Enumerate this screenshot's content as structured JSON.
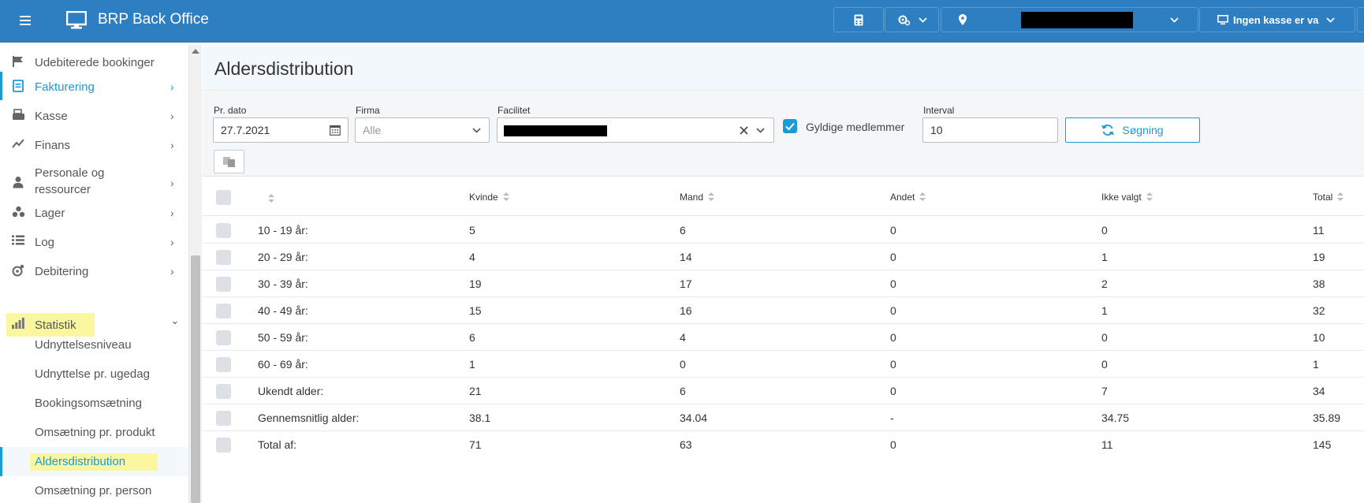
{
  "header": {
    "title": "BRP Back Office",
    "cash_register": "Ingen kasse er va"
  },
  "sidebar": {
    "items": [
      {
        "label": "Udebiterede bookinger",
        "icon": "flag-icon",
        "chevron": ""
      },
      {
        "label": "Fakturering",
        "icon": "invoice-icon",
        "chevron": "›"
      },
      {
        "label": "Kasse",
        "icon": "cash-register-icon",
        "chevron": "›"
      },
      {
        "label": "Finans",
        "icon": "trend-icon",
        "chevron": "›"
      },
      {
        "label": "Personale og",
        "label2": "ressourcer",
        "icon": "staff-icon",
        "chevron": "›"
      },
      {
        "label": "Lager",
        "icon": "boxes-icon",
        "chevron": "›"
      },
      {
        "label": "Log",
        "icon": "list-icon",
        "chevron": "›"
      },
      {
        "label": "Debitering",
        "icon": "debit-icon",
        "chevron": "›"
      },
      {
        "label": "Statistik",
        "icon": "bar-chart-icon",
        "chevron": "⌄"
      }
    ],
    "subitems": [
      "Udnyttelsesniveau",
      "Udnyttelse pr. ugedag",
      "Bookingsomsætning",
      "Omsætning pr. produkt",
      "Aldersdistribution",
      "Omsætning pr. person"
    ]
  },
  "page": {
    "title": "Aldersdistribution"
  },
  "filters": {
    "date_label": "Pr. dato",
    "date_value": "27.7.2021",
    "firma_label": "Firma",
    "firma_placeholder": "Alle",
    "facilitet_label": "Facilitet",
    "valid_members_label": "Gyldige medlemmer",
    "interval_label": "Interval",
    "interval_value": "10",
    "search_label": "Søgning"
  },
  "table": {
    "columns": [
      "Kvinde",
      "Mand",
      "Andet",
      "Ikke valgt",
      "Total"
    ],
    "rows": [
      {
        "label": "10 - 19 år:",
        "values": [
          "5",
          "6",
          "0",
          "0",
          "11"
        ]
      },
      {
        "label": "20 - 29 år:",
        "values": [
          "4",
          "14",
          "0",
          "1",
          "19"
        ]
      },
      {
        "label": "30 - 39 år:",
        "values": [
          "19",
          "17",
          "0",
          "2",
          "38"
        ]
      },
      {
        "label": "40 - 49 år:",
        "values": [
          "15",
          "16",
          "0",
          "1",
          "32"
        ]
      },
      {
        "label": "50 - 59 år:",
        "values": [
          "6",
          "4",
          "0",
          "0",
          "10"
        ]
      },
      {
        "label": "60 - 69 år:",
        "values": [
          "1",
          "0",
          "0",
          "0",
          "1"
        ]
      },
      {
        "label": "Ukendt alder:",
        "values": [
          "21",
          "6",
          "0",
          "7",
          "34"
        ]
      },
      {
        "label": "Gennemsnitlig alder:",
        "values": [
          "38.1",
          "34.04",
          "-",
          "34.75",
          "35.89"
        ]
      },
      {
        "label": "Total af:",
        "values": [
          "71",
          "63",
          "0",
          "11",
          "145"
        ]
      }
    ]
  }
}
